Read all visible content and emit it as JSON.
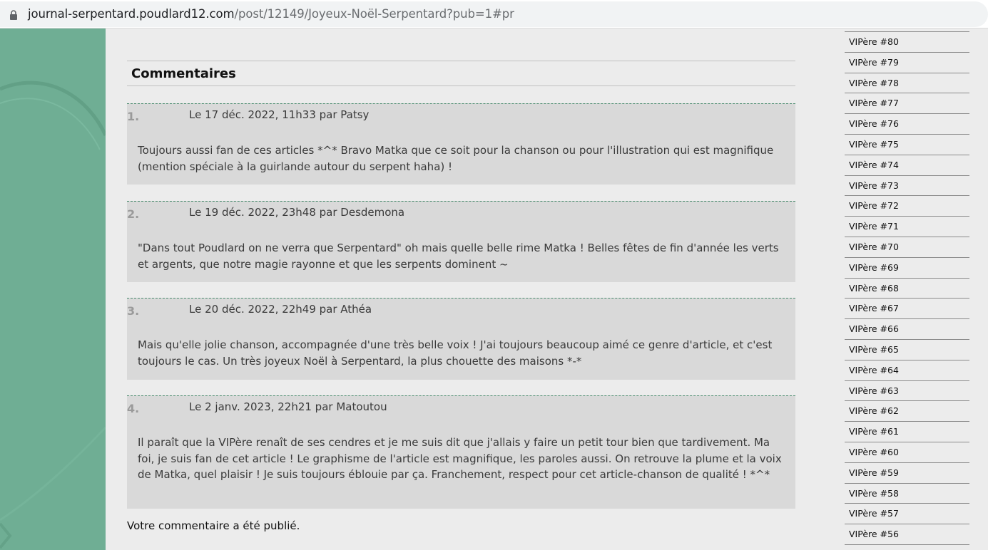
{
  "browser": {
    "url_host": "journal-serpentard.poudlard12.com",
    "url_path": "/post/12149/Joyeux-Noël-Serpentard?pub=1#pr"
  },
  "comments": {
    "title": "Commentaires",
    "items": [
      {
        "number": "1.",
        "meta": "Le 17 déc. 2022, 11h33 par Patsy",
        "text": "Toujours aussi fan de ces articles *^* Bravo Matka que ce soit pour la chanson ou pour l'illustration qui est magnifique (mention spéciale à la guirlande autour du serpent haha) !"
      },
      {
        "number": "2.",
        "meta": "Le 19 déc. 2022, 23h48 par Desdemona",
        "text": "\"Dans tout Poudlard on ne verra que Serpentard\" oh mais quelle belle rime Matka ! Belles fêtes de fin d'année les verts et argents, que notre magie rayonne et que les serpents dominent ~"
      },
      {
        "number": "3.",
        "meta": "Le 20 déc. 2022, 22h49 par Athéa",
        "text": "Mais qu'elle jolie chanson, accompagnée d'une très belle voix ! J'ai toujours beaucoup aimé ce genre d'article, et c'est toujours le cas. Un très joyeux Noël à Serpentard, la plus chouette des maisons *-*"
      },
      {
        "number": "4.",
        "meta": "Le 2 janv. 2023, 22h21 par Matoutou",
        "text": "Il paraît que la VIPère renaît de ses cendres et je me suis dit que j'allais y faire un petit tour bien que tardivement. Ma foi, je suis fan de cet article ! Le graphisme de l'article est magnifique, les paroles aussi. On retrouve la plume et la voix de Matka, quel plaisir ! Je suis toujours éblouie par ça. Franchement, respect pour cet article-chanson de qualité ! *^*"
      }
    ],
    "published_message": "Votre commentaire a été publié."
  },
  "sidebar": {
    "items": [
      "VIPère #80",
      "VIPère #79",
      "VIPère #78",
      "VIPère #77",
      "VIPère #76",
      "VIPère #75",
      "VIPère #74",
      "VIPère #73",
      "VIPère #72",
      "VIPère #71",
      "VIPère #70",
      "VIPère #69",
      "VIPère #68",
      "VIPère #67",
      "VIPère #66",
      "VIPère #65",
      "VIPère #64",
      "VIPère #63",
      "VIPère #62",
      "VIPère #61",
      "VIPère #60",
      "VIPère #59",
      "VIPère #58",
      "VIPère #57",
      "VIPère #56"
    ]
  },
  "colors": {
    "green_panel": "#6fae94",
    "comment_border": "#4a8c6e",
    "comment_bg": "#d9d9d9"
  },
  "icons": {
    "address_bar": "lock-icon"
  }
}
